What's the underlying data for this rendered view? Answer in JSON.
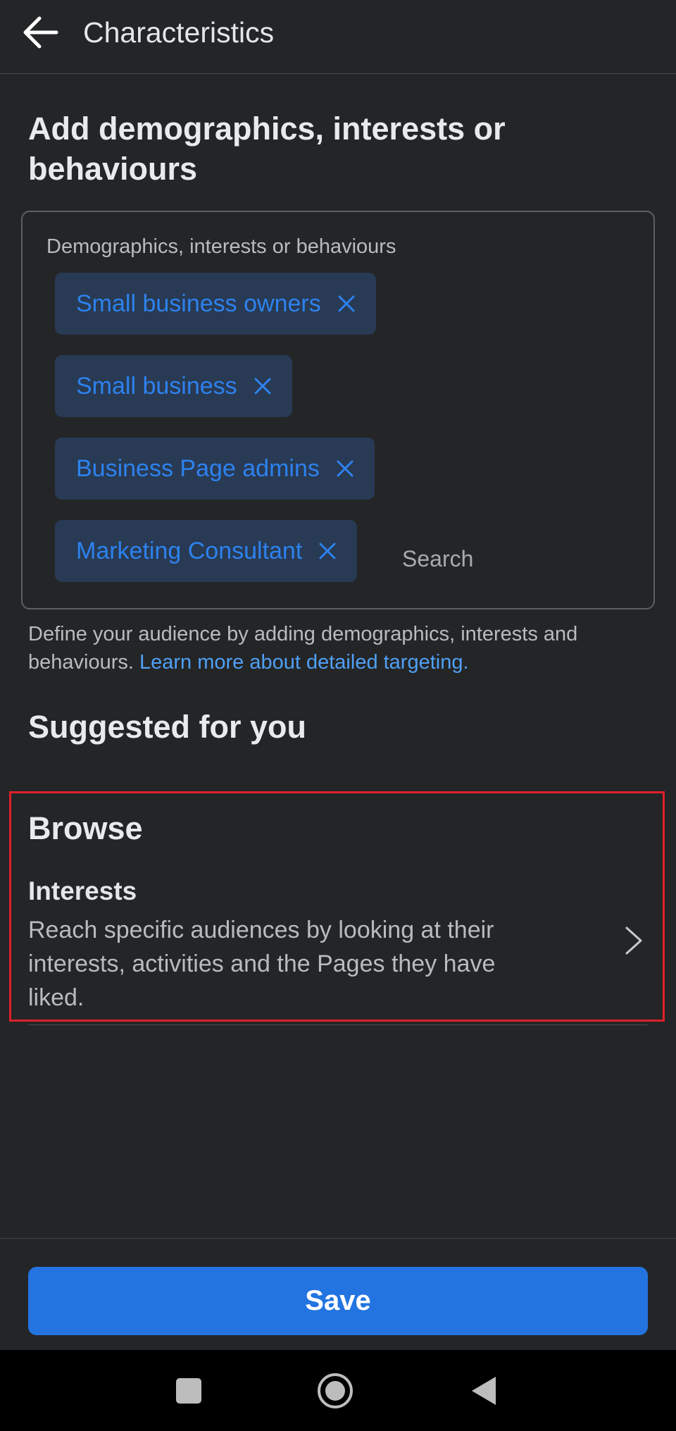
{
  "appbar": {
    "title": "Characteristics",
    "back_icon": "arrow-left-icon"
  },
  "section": {
    "heading": "Add demographics, interests or behaviours",
    "field_label": "Demographics, interests or behaviours",
    "chips": [
      {
        "label": "Small business owners"
      },
      {
        "label": "Small business"
      },
      {
        "label": "Business Page admins"
      },
      {
        "label": "Marketing Consultant"
      }
    ],
    "chip_remove_icon": "close-icon",
    "search_placeholder": "Search",
    "helper_text": "Define your audience by adding demographics, interests and behaviours. ",
    "helper_link": "Learn more about detailed targeting."
  },
  "suggested": {
    "title": "Suggested for you"
  },
  "browse": {
    "title": "Browse",
    "item_title": "Interests",
    "item_description": "Reach specific audiences by looking at their interests, activities and the Pages they have liked.",
    "chevron_icon": "chevron-right-icon"
  },
  "footer": {
    "save_label": "Save"
  },
  "navbar": {
    "icons": [
      "square-icon",
      "circle-home-icon",
      "triangle-back-icon"
    ]
  },
  "colors": {
    "background": "#242527",
    "accent": "#2374e1",
    "chip_bg": "#283a54",
    "chip_text": "#2d82ee",
    "link": "#4fa0f5",
    "highlight": "#e0202a"
  }
}
